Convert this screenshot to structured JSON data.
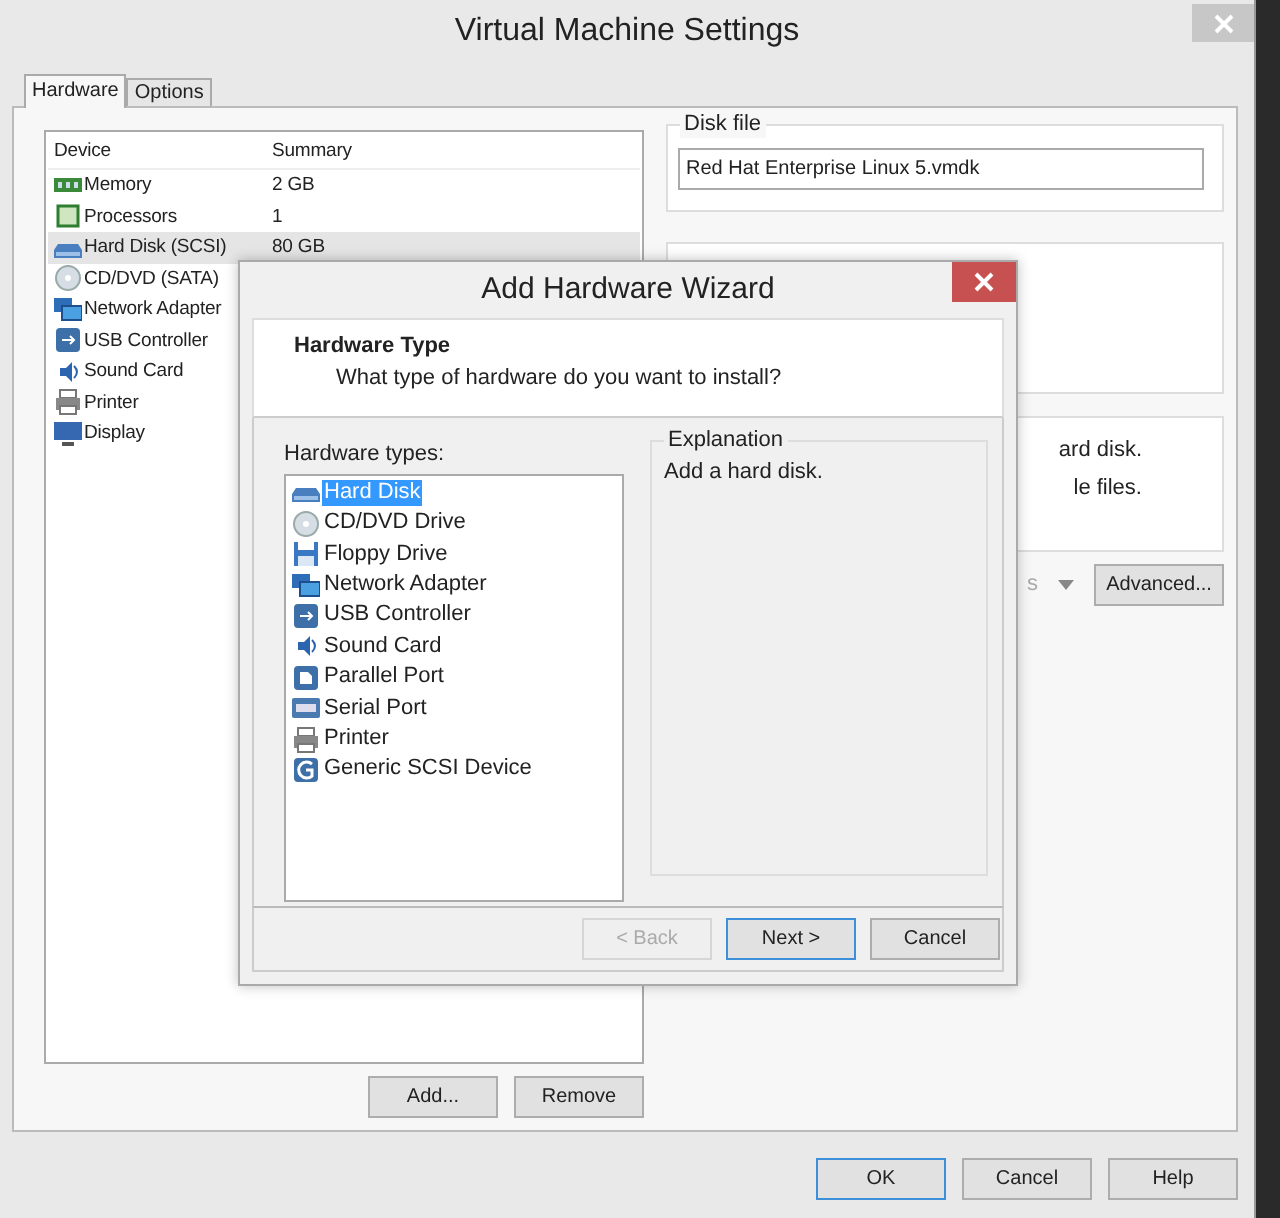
{
  "window": {
    "title": "Virtual Machine Settings"
  },
  "tabs": [
    {
      "label": "Hardware",
      "selected": true
    },
    {
      "label": "Options",
      "selected": false
    }
  ],
  "device_table": {
    "columns": [
      "Device",
      "Summary"
    ],
    "rows": [
      {
        "device": "Memory",
        "summary": "2 GB",
        "kind": "memory",
        "selected": false
      },
      {
        "device": "Processors",
        "summary": "1",
        "kind": "processor",
        "selected": false
      },
      {
        "device": "Hard Disk (SCSI)",
        "summary": "80 GB",
        "kind": "harddisk",
        "selected": true
      },
      {
        "device": "CD/DVD (SATA)",
        "kind": "cd",
        "selected": false
      },
      {
        "device": "Network Adapter",
        "kind": "network",
        "selected": false
      },
      {
        "device": "USB Controller",
        "kind": "usb",
        "selected": false
      },
      {
        "device": "Sound Card",
        "kind": "sound",
        "selected": false
      },
      {
        "device": "Printer",
        "kind": "printer",
        "selected": false
      },
      {
        "device": "Display",
        "kind": "display",
        "selected": false
      }
    ]
  },
  "device_buttons": [
    "Add...",
    "Remove"
  ],
  "disk_file": {
    "label": "Disk file",
    "value": "Red Hat Enterprise Linux 5.vmdk"
  },
  "info_lines": [
    "ard disk.",
    "le files."
  ],
  "combo": {
    "value": "s",
    "disabled": true
  },
  "advanced_button": "Advanced...",
  "footer_buttons": [
    {
      "label": "OK",
      "default": true
    },
    {
      "label": "Cancel",
      "default": false
    },
    {
      "label": "Help",
      "default": false
    }
  ],
  "wizard": {
    "title": "Add Hardware Wizard",
    "heading": "Hardware Type",
    "subheading": "What type of hardware do you want to install?",
    "list_label": "Hardware types:",
    "items": [
      {
        "label": "Hard Disk",
        "kind": "harddisk",
        "selected": true
      },
      {
        "label": "CD/DVD Drive",
        "kind": "cd",
        "selected": false
      },
      {
        "label": "Floppy Drive",
        "kind": "floppy",
        "selected": false
      },
      {
        "label": "Network Adapter",
        "kind": "network",
        "selected": false
      },
      {
        "label": "USB Controller",
        "kind": "usb",
        "selected": false
      },
      {
        "label": "Sound Card",
        "kind": "sound",
        "selected": false
      },
      {
        "label": "Parallel Port",
        "kind": "parallel",
        "selected": false
      },
      {
        "label": "Serial Port",
        "kind": "serial",
        "selected": false
      },
      {
        "label": "Printer",
        "kind": "printer",
        "selected": false
      },
      {
        "label": "Generic SCSI Device",
        "kind": "scsi",
        "selected": false
      }
    ],
    "explanation": {
      "label": "Explanation",
      "text": "Add a hard disk."
    },
    "buttons": [
      {
        "label": "< Back",
        "disabled": true,
        "default": false
      },
      {
        "label": "Next >",
        "disabled": false,
        "default": true
      },
      {
        "label": "Cancel",
        "disabled": false,
        "default": false
      }
    ]
  }
}
